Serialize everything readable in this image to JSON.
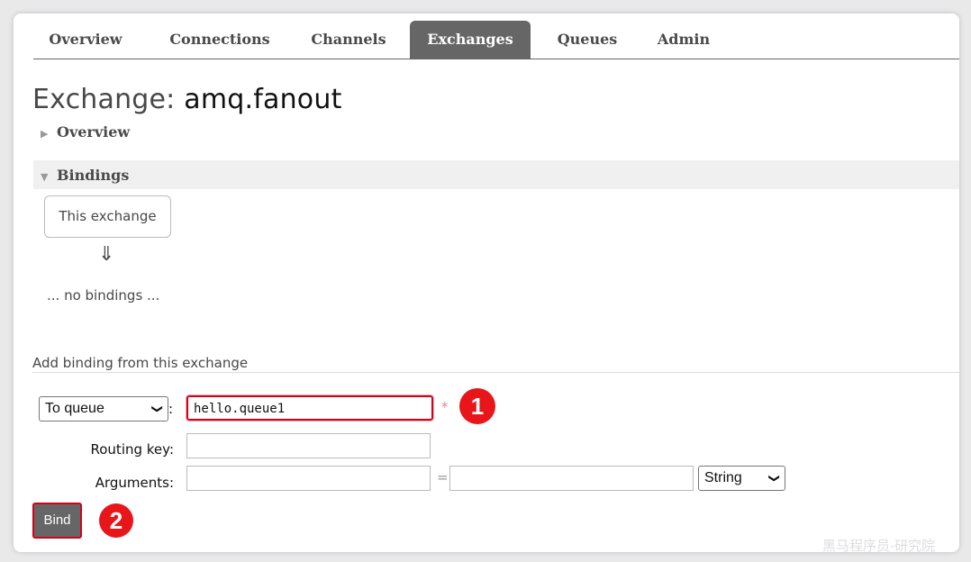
{
  "tabs": [
    {
      "label": "Overview"
    },
    {
      "label": "Connections"
    },
    {
      "label": "Channels"
    },
    {
      "label": "Exchanges"
    },
    {
      "label": "Queues"
    },
    {
      "label": "Admin"
    }
  ],
  "active_tab": "Exchanges",
  "page": {
    "title_prefix": "Exchange:",
    "title_name": "amq.fanout"
  },
  "sections": {
    "overview_label": "Overview",
    "bindings_label": "Bindings"
  },
  "bindings": {
    "this_exchange": "This exchange",
    "arrow": "⇓",
    "empty_text": "... no bindings ..."
  },
  "add_binding": {
    "header": "Add binding from this exchange",
    "destination_type": "To queue",
    "destination_value": "hello.queue1",
    "required_mark": "*",
    "routing_key_label": "Routing key:",
    "routing_key_value": "",
    "arguments_label": "Arguments:",
    "arg_key": "",
    "arg_value": "",
    "arg_type": "String",
    "bind_label": "Bind"
  },
  "annotations": {
    "badge1": "1",
    "badge2": "2"
  },
  "watermark": "黑马程序员-研究院",
  "colors": {
    "active_tab": "#666666",
    "highlight": "#d0021b",
    "badge": "#e8161a"
  }
}
